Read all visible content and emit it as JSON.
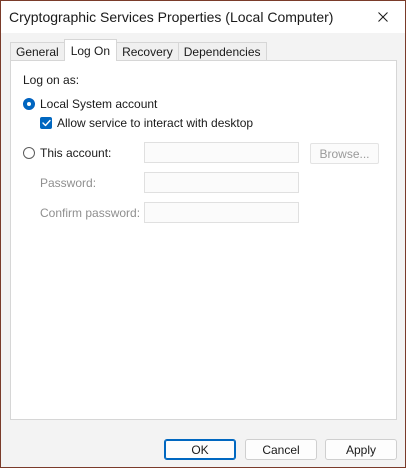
{
  "window": {
    "title": "Cryptographic Services Properties (Local Computer)"
  },
  "tabs": [
    {
      "label": "General",
      "active": false
    },
    {
      "label": "Log On",
      "active": true
    },
    {
      "label": "Recovery",
      "active": false
    },
    {
      "label": "Dependencies",
      "active": false
    }
  ],
  "logon": {
    "section_label": "Log on as:",
    "local_system_label": "Local System account",
    "local_system_selected": true,
    "interact_label": "Allow service to interact with desktop",
    "interact_checked": true,
    "this_account_label": "This account:",
    "this_account_selected": false,
    "account_value": "",
    "browse_label": "Browse...",
    "password_label": "Password:",
    "password_value": "",
    "confirm_label": "Confirm password:",
    "confirm_value": ""
  },
  "buttons": {
    "ok": "OK",
    "cancel": "Cancel",
    "apply": "Apply"
  },
  "icons": {
    "close": "close-icon",
    "checkmark": "checkmark-icon"
  },
  "colors": {
    "accent": "#0067c0",
    "window_border": "#7a3b2a"
  }
}
